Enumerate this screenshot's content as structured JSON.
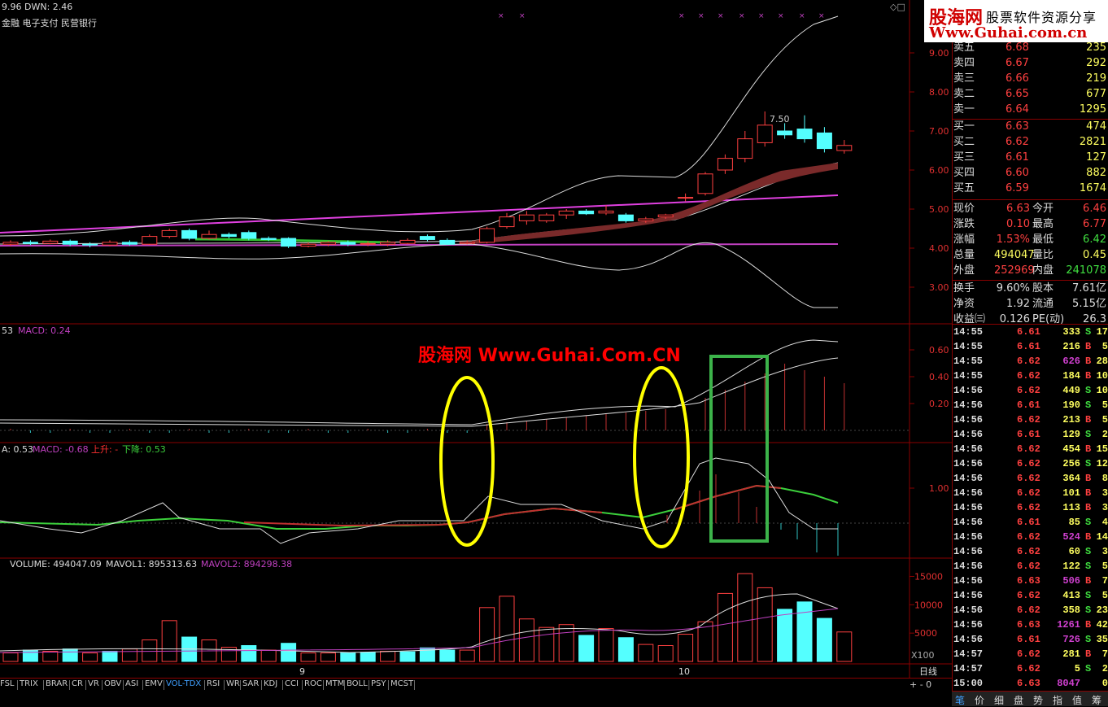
{
  "header": {
    "top_line": "9.96 DWN: 2.46",
    "tags": "金融 电子支付 民营银行",
    "max_label": "7.50"
  },
  "price_axis": [
    "9.00",
    "8.00",
    "7.00",
    "6.00",
    "5.00",
    "4.00",
    "3.00"
  ],
  "macd1": {
    "label_a": "53",
    "label_b": "MACD: 0.24",
    "axis": [
      "0.60",
      "0.40",
      "0.20"
    ]
  },
  "macd2": {
    "label_a": "A: 0.53",
    "label_b": "MACD: -0.68",
    "label_c": "上升: -",
    "label_d": "下降: 0.53",
    "axis": [
      "1.00"
    ]
  },
  "volume": {
    "label_a": "VOLUME: 494047.09",
    "label_b": "MAVOL1: 895313.63",
    "label_c": "MAVOL2: 894298.38",
    "axis": [
      "15000",
      "10000",
      "5000"
    ],
    "unit": "X100"
  },
  "date_labels": [
    "9",
    "10"
  ],
  "period": "日线",
  "watermark": "股海网 Www.Guhai.Com.CN",
  "logo": {
    "l1": "股海网",
    "l2": "股票软件资源分享",
    "l3": "Www.Guhai.com.cn"
  },
  "order_book": [
    {
      "label": "卖五",
      "price": "6.68",
      "vol": "235"
    },
    {
      "label": "卖四",
      "price": "6.67",
      "vol": "292"
    },
    {
      "label": "卖三",
      "price": "6.66",
      "vol": "219"
    },
    {
      "label": "卖二",
      "price": "6.65",
      "vol": "677"
    },
    {
      "label": "卖一",
      "price": "6.64",
      "vol": "1295"
    },
    {
      "label": "买一",
      "price": "6.63",
      "vol": "474"
    },
    {
      "label": "买二",
      "price": "6.62",
      "vol": "2821"
    },
    {
      "label": "买三",
      "price": "6.61",
      "vol": "127"
    },
    {
      "label": "买四",
      "price": "6.60",
      "vol": "882"
    },
    {
      "label": "买五",
      "price": "6.59",
      "vol": "1674"
    }
  ],
  "quote": [
    {
      "l1": "现价",
      "v1": "6.63",
      "l2": "今开",
      "v2": "6.46"
    },
    {
      "l1": "涨跌",
      "v1": "0.10",
      "l2": "最高",
      "v2": "6.77"
    },
    {
      "l1": "涨幅",
      "v1": "1.53%",
      "l2": "最低",
      "v2": "6.42"
    },
    {
      "l1": "总量",
      "v1": "494047",
      "l2": "量比",
      "v2": "0.45"
    },
    {
      "l1": "外盘",
      "v1": "252969",
      "l2": "内盘",
      "v2": "241078"
    }
  ],
  "stats": [
    {
      "l1": "换手",
      "v1": "9.60%",
      "l2": "股本",
      "v2": "7.61亿"
    },
    {
      "l1": "净资",
      "v1": "1.92",
      "l2": "流通",
      "v2": "5.15亿"
    },
    {
      "l1": "收益㈢",
      "v1": "0.126",
      "l2": "PE(动)",
      "v2": "26.3"
    }
  ],
  "ticks": [
    {
      "t": "14:55",
      "p": "6.61",
      "v": "333",
      "d": "S",
      "n": "17"
    },
    {
      "t": "14:55",
      "p": "6.61",
      "v": "216",
      "d": "B",
      "n": "5"
    },
    {
      "t": "14:55",
      "p": "6.62",
      "v": "626",
      "d": "B",
      "n": "28"
    },
    {
      "t": "14:55",
      "p": "6.62",
      "v": "184",
      "d": "B",
      "n": "10"
    },
    {
      "t": "14:56",
      "p": "6.62",
      "v": "449",
      "d": "S",
      "n": "10"
    },
    {
      "t": "14:56",
      "p": "6.61",
      "v": "190",
      "d": "S",
      "n": "5"
    },
    {
      "t": "14:56",
      "p": "6.62",
      "v": "213",
      "d": "B",
      "n": "5"
    },
    {
      "t": "14:56",
      "p": "6.61",
      "v": "129",
      "d": "S",
      "n": "2"
    },
    {
      "t": "14:56",
      "p": "6.62",
      "v": "454",
      "d": "B",
      "n": "15"
    },
    {
      "t": "14:56",
      "p": "6.62",
      "v": "256",
      "d": "S",
      "n": "12"
    },
    {
      "t": "14:56",
      "p": "6.62",
      "v": "364",
      "d": "B",
      "n": "8"
    },
    {
      "t": "14:56",
      "p": "6.62",
      "v": "101",
      "d": "B",
      "n": "3"
    },
    {
      "t": "14:56",
      "p": "6.62",
      "v": "113",
      "d": "B",
      "n": "3"
    },
    {
      "t": "14:56",
      "p": "6.61",
      "v": "85",
      "d": "S",
      "n": "4"
    },
    {
      "t": "14:56",
      "p": "6.62",
      "v": "524",
      "d": "B",
      "n": "14"
    },
    {
      "t": "14:56",
      "p": "6.62",
      "v": "60",
      "d": "S",
      "n": "3"
    },
    {
      "t": "14:56",
      "p": "6.62",
      "v": "122",
      "d": "S",
      "n": "5"
    },
    {
      "t": "14:56",
      "p": "6.63",
      "v": "506",
      "d": "B",
      "n": "7"
    },
    {
      "t": "14:56",
      "p": "6.62",
      "v": "413",
      "d": "S",
      "n": "5"
    },
    {
      "t": "14:56",
      "p": "6.62",
      "v": "358",
      "d": "S",
      "n": "23"
    },
    {
      "t": "14:56",
      "p": "6.63",
      "v": "1261",
      "d": "B",
      "n": "42"
    },
    {
      "t": "14:56",
      "p": "6.61",
      "v": "726",
      "d": "S",
      "n": "35"
    },
    {
      "t": "14:57",
      "p": "6.62",
      "v": "281",
      "d": "B",
      "n": "7"
    },
    {
      "t": "14:57",
      "p": "6.62",
      "v": "5",
      "d": "S",
      "n": "2"
    },
    {
      "t": "15:00",
      "p": "6.63",
      "v": "8047",
      "d": "",
      "n": "0"
    }
  ],
  "indicator_tabs": [
    "FSL",
    "TRIX",
    "BRAR",
    "CR",
    "VR",
    "OBV",
    "ASI",
    "EMV",
    "VOL-TDX",
    "RSI",
    "WR",
    "SAR",
    "KDJ",
    "CCI",
    "ROC",
    "MTM",
    "BOLL",
    "PSY",
    "MCST"
  ],
  "bottom_tabs": [
    "笔",
    "价",
    "细",
    "盘",
    "势",
    "指",
    "值",
    "筹"
  ],
  "candles": [
    {
      "o": 4.1,
      "c": 4.15,
      "h": 4.2,
      "l": 4.05
    },
    {
      "o": 4.15,
      "c": 4.12,
      "h": 4.2,
      "l": 4.08
    },
    {
      "o": 4.12,
      "c": 4.18,
      "h": 4.22,
      "l": 4.1
    },
    {
      "o": 4.18,
      "c": 4.1,
      "h": 4.22,
      "l": 4.05
    },
    {
      "o": 4.1,
      "c": 4.08,
      "h": 4.15,
      "l": 4.02
    },
    {
      "o": 4.08,
      "c": 4.15,
      "h": 4.2,
      "l": 4.05
    },
    {
      "o": 4.15,
      "c": 4.1,
      "h": 4.2,
      "l": 4.06
    },
    {
      "o": 4.1,
      "c": 4.3,
      "h": 4.35,
      "l": 4.08
    },
    {
      "o": 4.3,
      "c": 4.45,
      "h": 4.5,
      "l": 4.25
    },
    {
      "o": 4.45,
      "c": 4.25,
      "h": 4.5,
      "l": 4.2
    },
    {
      "o": 4.25,
      "c": 4.35,
      "h": 4.45,
      "l": 4.22
    },
    {
      "o": 4.35,
      "c": 4.3,
      "h": 4.4,
      "l": 4.25
    },
    {
      "o": 4.4,
      "c": 4.25,
      "h": 4.45,
      "l": 4.2
    },
    {
      "o": 4.25,
      "c": 4.22,
      "h": 4.3,
      "l": 4.18
    },
    {
      "o": 4.25,
      "c": 4.05,
      "h": 4.28,
      "l": 4.0
    },
    {
      "o": 4.05,
      "c": 4.1,
      "h": 4.15,
      "l": 4.02
    },
    {
      "o": 4.1,
      "c": 4.15,
      "h": 4.18,
      "l": 4.05
    },
    {
      "o": 4.15,
      "c": 4.1,
      "h": 4.2,
      "l": 4.05
    },
    {
      "o": 4.1,
      "c": 4.12,
      "h": 4.18,
      "l": 4.05
    },
    {
      "o": 4.1,
      "c": 4.15,
      "h": 4.2,
      "l": 4.05
    },
    {
      "o": 4.12,
      "c": 4.2,
      "h": 4.25,
      "l": 4.1
    },
    {
      "o": 4.3,
      "c": 4.22,
      "h": 4.35,
      "l": 4.18
    },
    {
      "o": 4.2,
      "c": 4.1,
      "h": 4.25,
      "l": 4.08
    },
    {
      "o": 4.12,
      "c": 4.15,
      "h": 4.2,
      "l": 4.1
    },
    {
      "o": 4.15,
      "c": 4.5,
      "h": 4.55,
      "l": 4.12
    },
    {
      "o": 4.55,
      "c": 4.8,
      "h": 4.9,
      "l": 4.5
    },
    {
      "o": 4.7,
      "c": 4.85,
      "h": 4.95,
      "l": 4.6
    },
    {
      "o": 4.7,
      "c": 4.85,
      "h": 4.9,
      "l": 4.65
    },
    {
      "o": 4.85,
      "c": 4.95,
      "h": 5.0,
      "l": 4.75
    },
    {
      "o": 4.95,
      "c": 4.88,
      "h": 5.0,
      "l": 4.85
    },
    {
      "o": 4.9,
      "c": 4.95,
      "h": 5.1,
      "l": 4.85
    },
    {
      "o": 4.85,
      "c": 4.7,
      "h": 4.9,
      "l": 4.65
    },
    {
      "o": 4.7,
      "c": 4.75,
      "h": 4.8,
      "l": 4.65
    },
    {
      "o": 4.8,
      "c": 4.85,
      "h": 4.88,
      "l": 4.75
    },
    {
      "o": 5.3,
      "c": 5.3,
      "h": 5.4,
      "l": 5.2
    },
    {
      "o": 5.4,
      "c": 5.9,
      "h": 5.95,
      "l": 5.35
    },
    {
      "o": 6.0,
      "c": 6.3,
      "h": 6.4,
      "l": 5.9
    },
    {
      "o": 6.3,
      "c": 6.8,
      "h": 7.0,
      "l": 6.2
    },
    {
      "o": 6.7,
      "c": 7.15,
      "h": 7.5,
      "l": 6.6
    },
    {
      "o": 7.0,
      "c": 6.9,
      "h": 7.2,
      "l": 6.8
    },
    {
      "o": 7.05,
      "c": 6.8,
      "h": 7.4,
      "l": 6.7
    },
    {
      "o": 6.95,
      "c": 6.55,
      "h": 7.1,
      "l": 6.45
    },
    {
      "o": 6.5,
      "c": 6.63,
      "h": 6.77,
      "l": 6.42
    }
  ],
  "volume_bars": [
    {
      "v": 1500,
      "up": true
    },
    {
      "v": 2000,
      "up": false
    },
    {
      "v": 1800,
      "up": true
    },
    {
      "v": 2200,
      "up": false
    },
    {
      "v": 1500,
      "up": true
    },
    {
      "v": 1800,
      "up": false
    },
    {
      "v": 2200,
      "up": true
    },
    {
      "v": 3800,
      "up": true
    },
    {
      "v": 7200,
      "up": true
    },
    {
      "v": 4300,
      "up": false
    },
    {
      "v": 3800,
      "up": true
    },
    {
      "v": 2500,
      "up": true
    },
    {
      "v": 2800,
      "up": false
    },
    {
      "v": 2000,
      "up": true
    },
    {
      "v": 3200,
      "up": false
    },
    {
      "v": 1500,
      "up": true
    },
    {
      "v": 1500,
      "up": true
    },
    {
      "v": 1500,
      "up": false
    },
    {
      "v": 1600,
      "up": false
    },
    {
      "v": 1800,
      "up": true
    },
    {
      "v": 1700,
      "up": false
    },
    {
      "v": 2400,
      "up": false
    },
    {
      "v": 2000,
      "up": false
    },
    {
      "v": 2000,
      "up": true
    },
    {
      "v": 9500,
      "up": true
    },
    {
      "v": 11500,
      "up": true
    },
    {
      "v": 7500,
      "up": true
    },
    {
      "v": 6000,
      "up": true
    },
    {
      "v": 6500,
      "up": true
    },
    {
      "v": 4600,
      "up": false
    },
    {
      "v": 5800,
      "up": true
    },
    {
      "v": 4200,
      "up": false
    },
    {
      "v": 3000,
      "up": true
    },
    {
      "v": 2800,
      "up": true
    },
    {
      "v": 4800,
      "up": true
    },
    {
      "v": 7000,
      "up": true
    },
    {
      "v": 12000,
      "up": true
    },
    {
      "v": 15500,
      "up": true
    },
    {
      "v": 13000,
      "up": true
    },
    {
      "v": 9200,
      "up": false
    },
    {
      "v": 10500,
      "up": false
    },
    {
      "v": 7600,
      "up": false
    },
    {
      "v": 5200,
      "up": true
    }
  ]
}
